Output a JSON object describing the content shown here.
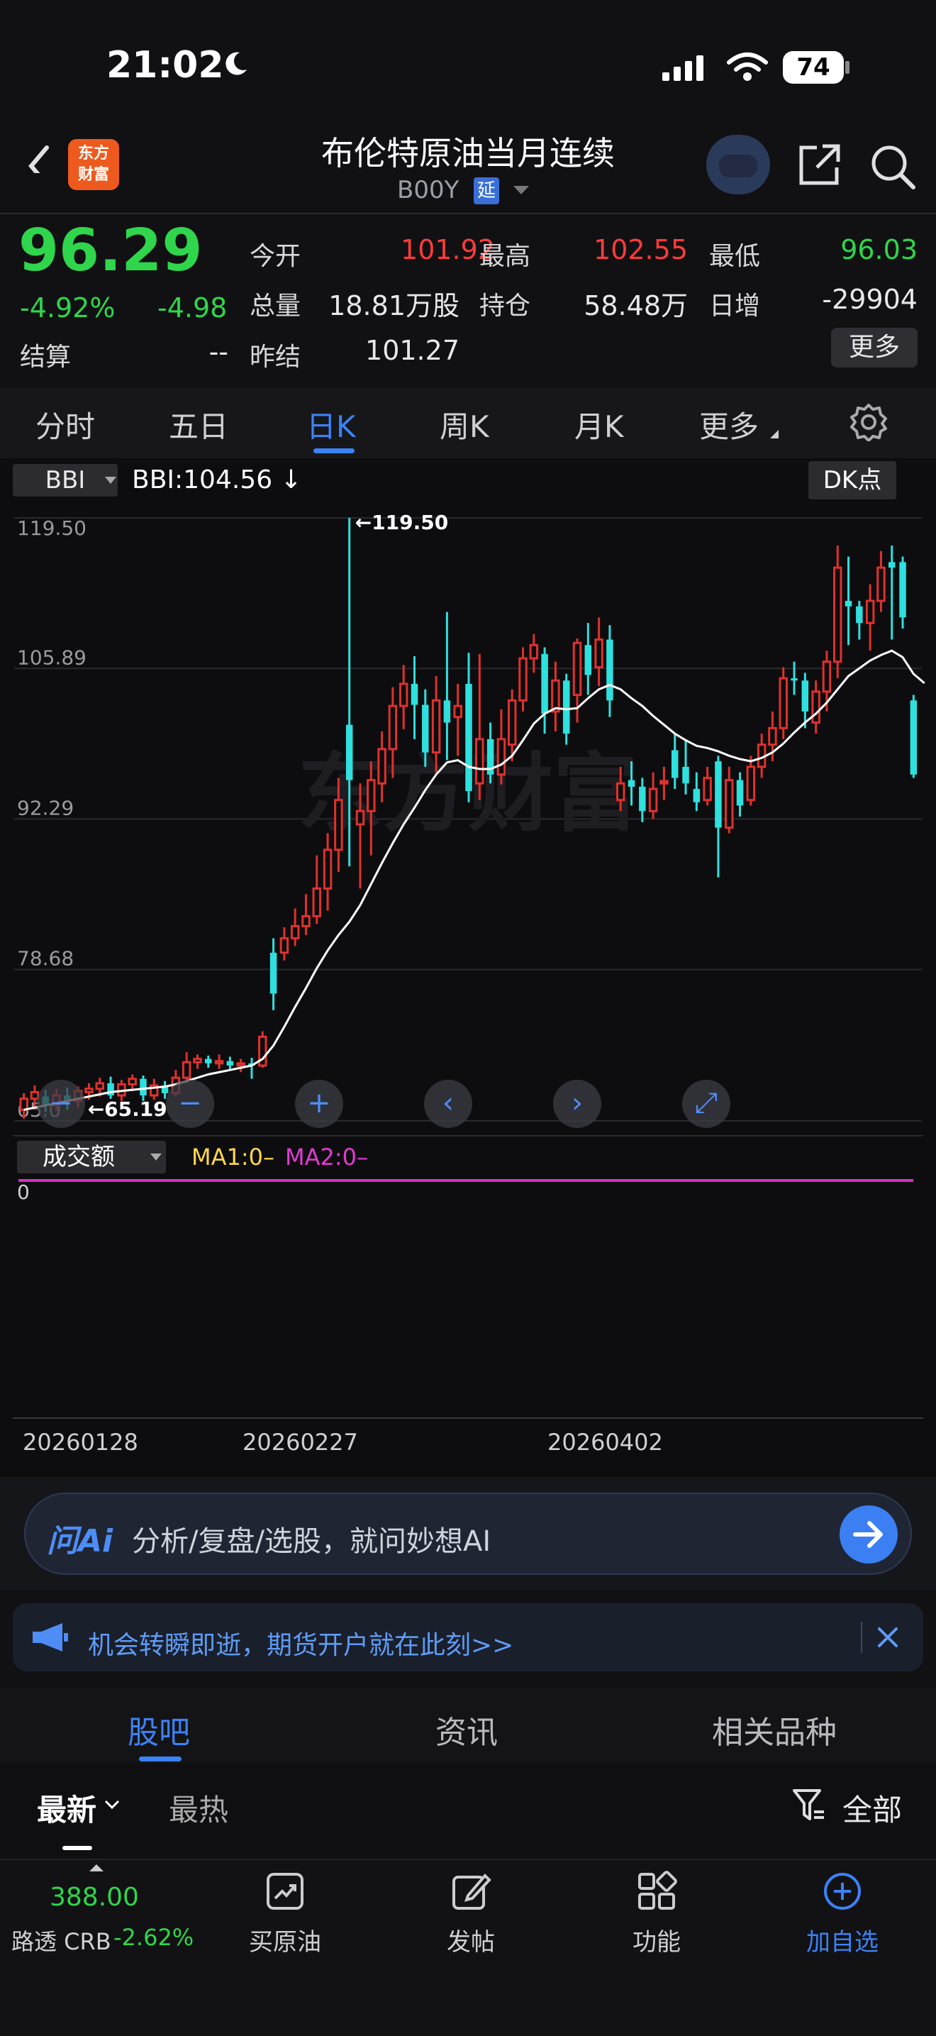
{
  "status_bar": {
    "time": "21:02",
    "battery": "74"
  },
  "header": {
    "logo_line1": "东方",
    "logo_line2": "财富",
    "title": "布伦特原油当月连续",
    "code": "B00Y",
    "delay_badge": "延"
  },
  "quote": {
    "price": "96.29",
    "change_pct": "-4.92%",
    "change": "-4.98",
    "settle_label": "结算",
    "settle_value": "--",
    "open_label": "今开",
    "open_value": "101.92",
    "high_label": "最高",
    "high_value": "102.55",
    "low_label": "最低",
    "low_value": "96.03",
    "volume_label": "总量",
    "volume_value": "18.81万股",
    "oi_label": "持仓",
    "oi_value": "58.48万",
    "daily_inc_label": "日增",
    "daily_inc_value": "-29904",
    "prev_settle_label": "昨结",
    "prev_settle_value": "101.27",
    "more_label": "更多"
  },
  "period_tabs": [
    "分时",
    "五日",
    "日K",
    "周K",
    "月K",
    "更多"
  ],
  "active_tab": "日K",
  "indicator": {
    "name": "BBI",
    "readout": "BBI:104.56 ↓",
    "dk_label": "DK点"
  },
  "volume_panel": {
    "selector": "成交额",
    "ma1": "MA1:0–",
    "ma2": "MA2:0–",
    "zero": "0"
  },
  "dates": [
    "20260128",
    "20260227",
    "20260402"
  ],
  "chart_data": {
    "type": "candlestick",
    "y_ticks": [
      "119.50",
      "105.89",
      "92.29",
      "78.68",
      "65.0"
    ],
    "ylim": [
      65.0,
      119.5
    ],
    "max_label": "←119.50",
    "min_label": "←65.19",
    "candles": [
      [
        66,
        67,
        65.2,
        67.5,
        "up"
      ],
      [
        67,
        67.6,
        66,
        68.2,
        "up"
      ],
      [
        67.2,
        66.4,
        65.8,
        67.8,
        "down"
      ],
      [
        66.4,
        67.3,
        65.9,
        67.9,
        "up"
      ],
      [
        67.3,
        66.8,
        66.0,
        68.0,
        "down"
      ],
      [
        66.8,
        67.7,
        66.2,
        68.1,
        "up"
      ],
      [
        67.6,
        67.9,
        66.9,
        68.4,
        "up"
      ],
      [
        67.9,
        68.4,
        67.2,
        68.9,
        "up"
      ],
      [
        68.4,
        67.3,
        67.0,
        69.0,
        "down"
      ],
      [
        67.3,
        68.3,
        66.8,
        68.7,
        "up"
      ],
      [
        68.3,
        68.8,
        67.7,
        69.2,
        "up"
      ],
      [
        68.8,
        67.3,
        66.8,
        69.1,
        "down"
      ],
      [
        67.3,
        68.2,
        66.9,
        68.8,
        "up"
      ],
      [
        68.2,
        67.5,
        67.0,
        68.6,
        "down"
      ],
      [
        67.5,
        68.9,
        67.2,
        69.6,
        "up"
      ],
      [
        68.9,
        70.3,
        68.4,
        71.2,
        "up"
      ],
      [
        70.3,
        70.6,
        69.7,
        71.0,
        "up"
      ],
      [
        70.6,
        70.2,
        69.8,
        70.9,
        "down"
      ],
      [
        70.2,
        70.4,
        69.7,
        71.0,
        "up"
      ],
      [
        70.4,
        70.0,
        69.6,
        70.8,
        "down"
      ],
      [
        70.0,
        70.2,
        69.4,
        70.6,
        "up"
      ],
      [
        70.2,
        70.0,
        68.8,
        70.7,
        "down"
      ],
      [
        70.0,
        72.6,
        69.8,
        73.1,
        "up"
      ],
      [
        76.5,
        80.2,
        75.0,
        81.5,
        "down"
      ],
      [
        80.2,
        81.5,
        79.5,
        82.5,
        "up"
      ],
      [
        81.5,
        82.6,
        80.8,
        84.2,
        "up"
      ],
      [
        82.6,
        83.5,
        81.8,
        85.5,
        "up"
      ],
      [
        83.5,
        86.0,
        82.8,
        89.0,
        "up"
      ],
      [
        86.0,
        89.5,
        84.0,
        91.0,
        "up"
      ],
      [
        89.5,
        94.0,
        87.5,
        96.0,
        "up"
      ],
      [
        95.8,
        100.8,
        88.0,
        119.5,
        "down"
      ],
      [
        91.8,
        93.0,
        86.0,
        95.5,
        "up"
      ],
      [
        93.0,
        95.8,
        89.0,
        97.5,
        "up"
      ],
      [
        95.5,
        98.6,
        93.8,
        100.2,
        "up"
      ],
      [
        98.6,
        102.5,
        96.0,
        104.2,
        "up"
      ],
      [
        102.5,
        104.5,
        100.4,
        106.2,
        "up"
      ],
      [
        104.5,
        102.6,
        99.5,
        107.0,
        "down"
      ],
      [
        102.6,
        98.3,
        97.0,
        104.0,
        "down"
      ],
      [
        98.3,
        103.0,
        96.5,
        105.2,
        "up"
      ],
      [
        103.0,
        101.0,
        97.6,
        111.0,
        "down"
      ],
      [
        101.5,
        102.5,
        98.0,
        104.5,
        "up"
      ],
      [
        104.5,
        94.8,
        93.8,
        107.3,
        "down"
      ],
      [
        95.5,
        99.5,
        94.0,
        107.2,
        "up"
      ],
      [
        99.5,
        96.3,
        95.5,
        101.0,
        "down"
      ],
      [
        96.3,
        99.5,
        95.4,
        102.2,
        "up"
      ],
      [
        99.0,
        103.0,
        97.5,
        104.0,
        "up"
      ],
      [
        103.0,
        106.8,
        102.0,
        107.8,
        "up"
      ],
      [
        106.8,
        108.0,
        105.5,
        109.0,
        "up"
      ],
      [
        107.2,
        101.8,
        100.0,
        107.8,
        "down"
      ],
      [
        102.0,
        104.8,
        100.2,
        106.5,
        "up"
      ],
      [
        104.8,
        100.0,
        99.0,
        105.4,
        "down"
      ],
      [
        103.5,
        108.2,
        101.0,
        108.6,
        "up"
      ],
      [
        108.0,
        105.3,
        103.5,
        110.0,
        "down"
      ],
      [
        106.0,
        108.5,
        104.3,
        110.5,
        "up"
      ],
      [
        108.5,
        103.0,
        101.5,
        109.8,
        "down"
      ],
      [
        94.0,
        95.5,
        93.0,
        97.0,
        "up"
      ],
      [
        95.8,
        95.2,
        93.5,
        97.5,
        "down"
      ],
      [
        95.2,
        93.0,
        92.0,
        96.0,
        "down"
      ],
      [
        93.0,
        95.0,
        92.3,
        96.5,
        "up"
      ],
      [
        95.5,
        95.7,
        94.0,
        97.0,
        "up"
      ],
      [
        98.5,
        96.0,
        95.0,
        100.0,
        "down"
      ],
      [
        97.0,
        95.5,
        94.5,
        99.5,
        "down"
      ],
      [
        95.0,
        93.8,
        93.0,
        96.5,
        "down"
      ],
      [
        94.0,
        96.0,
        93.5,
        97.0,
        "up"
      ],
      [
        97.5,
        91.5,
        87.0,
        98.0,
        "down"
      ],
      [
        91.5,
        95.8,
        91.0,
        97.0,
        "up"
      ],
      [
        95.8,
        93.5,
        92.5,
        96.5,
        "down"
      ],
      [
        94.0,
        97.0,
        93.5,
        98.0,
        "up"
      ],
      [
        97.0,
        99.0,
        96.0,
        100.0,
        "up"
      ],
      [
        99.0,
        100.5,
        97.5,
        102.0,
        "up"
      ],
      [
        100.5,
        105.0,
        99.5,
        106.0,
        "up"
      ],
      [
        105.0,
        104.8,
        103.5,
        106.5,
        "down"
      ],
      [
        104.8,
        102.0,
        100.5,
        105.5,
        "down"
      ],
      [
        101.0,
        103.8,
        100.0,
        104.8,
        "up"
      ],
      [
        103.8,
        106.5,
        102.0,
        107.5,
        "up"
      ],
      [
        106.5,
        115.0,
        105.0,
        117.0,
        "up"
      ],
      [
        112.0,
        111.5,
        108.0,
        116.0,
        "down"
      ],
      [
        111.5,
        110.0,
        108.5,
        112.0,
        "down"
      ],
      [
        110.0,
        112.0,
        107.5,
        113.5,
        "up"
      ],
      [
        112.0,
        115.0,
        111.0,
        116.5,
        "up"
      ],
      [
        115.5,
        115.0,
        108.5,
        117.0,
        "down"
      ],
      [
        115.5,
        110.5,
        109.5,
        116.0,
        "down"
      ],
      [
        103.0,
        96.3,
        96.0,
        103.5,
        "down"
      ]
    ],
    "bbi": [
      66.0,
      66.2,
      66.4,
      66.6,
      66.8,
      67.0,
      67.2,
      67.4,
      67.6,
      67.7,
      67.8,
      67.9,
      68.0,
      68.1,
      68.3,
      68.6,
      68.9,
      69.2,
      69.4,
      69.6,
      69.8,
      70.0,
      70.6,
      71.8,
      73.5,
      75.3,
      77.0,
      78.8,
      80.4,
      81.8,
      83.0,
      84.5,
      86.4,
      88.3,
      90.1,
      91.8,
      93.3,
      94.9,
      96.3,
      97.4,
      97.6,
      97.0,
      96.8,
      96.8,
      97.2,
      98.0,
      99.4,
      100.9,
      101.8,
      102.3,
      102.2,
      102.3,
      103.2,
      104.0,
      104.4,
      104.0,
      103.2,
      102.5,
      101.6,
      100.8,
      100.0,
      99.4,
      98.9,
      98.7,
      98.4,
      98.0,
      97.7,
      97.5,
      97.8,
      98.3,
      99.1,
      100.1,
      101.0,
      101.8,
      102.8,
      104.0,
      105.2,
      105.9,
      106.6,
      107.1,
      107.5,
      106.9,
      105.4,
      104.56
    ]
  },
  "ai_bar": {
    "logo": "问Ai",
    "placeholder": "分析/复盘/选股，就问妙想AI"
  },
  "promo": {
    "text": "机会转瞬即逝，期货开户就在此刻>>"
  },
  "section_tabs": [
    "股吧",
    "资讯",
    "相关品种"
  ],
  "feed_tabs": {
    "latest": "最新",
    "hot": "最热",
    "filter": "全部"
  },
  "bottom_bar": {
    "ticker_price": "388.00",
    "ticker_name": "路透 CRB",
    "ticker_change": "-2.62%",
    "items": [
      "买原油",
      "发帖",
      "功能",
      "加自选"
    ]
  },
  "colors": {
    "up": "#e0312c",
    "down": "#2ee0de",
    "accent": "#3b82f6",
    "price_green": "#2fd64b"
  }
}
